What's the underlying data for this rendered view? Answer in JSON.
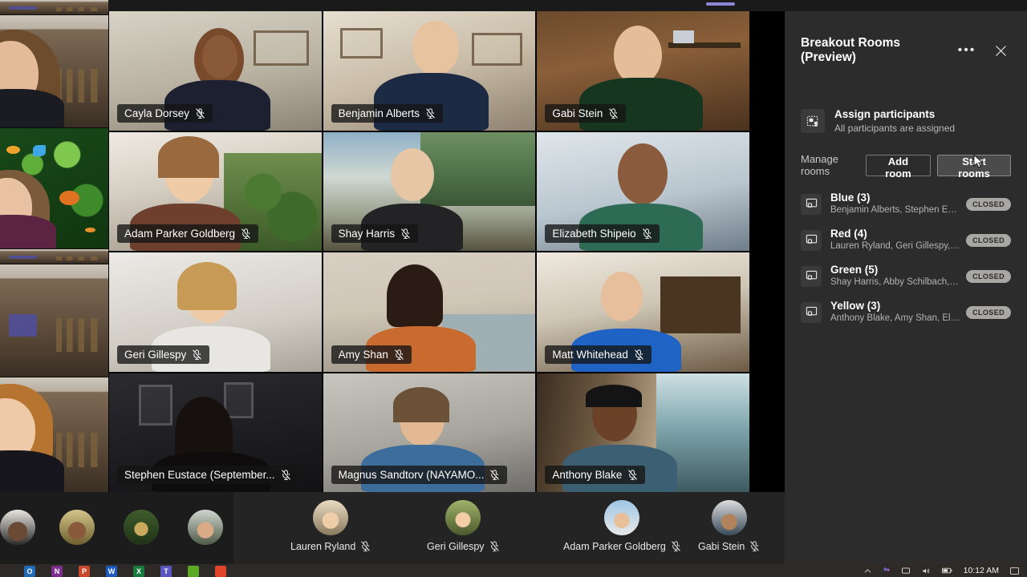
{
  "app": {
    "name": "Microsoft Teams meeting"
  },
  "panel": {
    "title": "Breakout Rooms (Preview)",
    "more_icon": "more-options-icon",
    "close_icon": "close-icon",
    "assign": {
      "icon": "assign-participants-icon",
      "title": "Assign participants",
      "subtitle": "All participants are assigned"
    },
    "manage": {
      "label": "Manage rooms",
      "add_room": "Add room",
      "start_rooms": "Start rooms"
    },
    "rooms": [
      {
        "icon": "room-icon",
        "name": "Blue (3)",
        "members": "Benjamin Alberts, Stephen Eusta...",
        "status": "CLOSED"
      },
      {
        "icon": "room-icon",
        "name": "Red (4)",
        "members": "Lauren Ryland, Geri Gillespy, Bry...",
        "status": "CLOSED"
      },
      {
        "icon": "room-icon",
        "name": "Green (5)",
        "members": "Shay Harris, Abby Schilbach, Ma...",
        "status": "CLOSED"
      },
      {
        "icon": "room-icon",
        "name": "Yellow (3)",
        "members": "Anthony Blake, Amy Shan, Eliza...",
        "status": "CLOSED"
      }
    ]
  },
  "grid": {
    "tiles": [
      {
        "name": "Cayla Dorsey",
        "muted": true,
        "scene": "sc-wall"
      },
      {
        "name": "Benjamin Alberts",
        "muted": true,
        "scene": "sc-warm"
      },
      {
        "name": "Gabi Stein",
        "muted": true,
        "scene": "sc-wood"
      },
      {
        "name": "Adam Parker Goldberg",
        "muted": true,
        "scene": "sc-room"
      },
      {
        "name": "Shay Harris",
        "muted": true,
        "scene": "sc-window"
      },
      {
        "name": "Elizabeth Shipeio",
        "muted": true,
        "scene": "sc-blue"
      },
      {
        "name": "Geri Gillespy",
        "muted": true,
        "scene": "sc-white"
      },
      {
        "name": "Amy Shan",
        "muted": true,
        "scene": "sc-sofa"
      },
      {
        "name": "Matt Whitehead",
        "muted": true,
        "scene": "sc-office"
      },
      {
        "name": "Stephen Eustace (September...",
        "muted": true,
        "scene": "sc-dark"
      },
      {
        "name": "Magnus Sandtorv (NAYAMO...",
        "muted": true,
        "scene": "sc-gray"
      },
      {
        "name": "Anthony Blake",
        "muted": true,
        "scene": "sc-hall"
      }
    ],
    "mic_off_icon": "mic-off-icon"
  },
  "filmstrip": {
    "left_avatars": [
      {
        "name": "",
        "avatar": "participant-avatar"
      },
      {
        "name": "",
        "avatar": "participant-avatar"
      },
      {
        "name": "",
        "avatar": "participant-avatar"
      },
      {
        "name": "",
        "avatar": "participant-avatar"
      }
    ],
    "named": [
      {
        "name": "Lauren Ryland",
        "muted": true,
        "avatar": "participant-avatar"
      },
      {
        "name": "Geri Gillespy",
        "muted": true,
        "avatar": "participant-avatar"
      },
      {
        "name": "Adam Parker Goldberg",
        "muted": true,
        "avatar": "participant-avatar"
      },
      {
        "name": "Gabi Stein",
        "muted": true,
        "avatar": "participant-avatar"
      }
    ]
  },
  "taskbar": {
    "apps": [
      {
        "name": "outlook-icon",
        "letter": "O",
        "color": "#1f6bb8"
      },
      {
        "name": "onenote-icon",
        "letter": "N",
        "color": "#7b2e8e"
      },
      {
        "name": "powerpoint-icon",
        "letter": "P",
        "color": "#c9472b"
      },
      {
        "name": "word-icon",
        "letter": "W",
        "color": "#1d5bbf"
      },
      {
        "name": "excel-icon",
        "letter": "X",
        "color": "#167a3c"
      },
      {
        "name": "teams-icon",
        "letter": "T",
        "color": "#5a56bd"
      },
      {
        "name": "green-app-icon",
        "letter": "",
        "color": "#5aab23"
      },
      {
        "name": "red-app-icon",
        "letter": "",
        "color": "#e0452a"
      }
    ],
    "tray": [
      "show-hidden-icons",
      "teams-tray-icon",
      "network-icon",
      "volume-icon",
      "battery-icon"
    ],
    "clock": "10:12 AM",
    "action_center_icon": "action-center-icon"
  },
  "colors": {
    "panel_bg": "#2d2c2c",
    "badge_bg": "#a9a7a4",
    "accent": "#8b86d8"
  }
}
